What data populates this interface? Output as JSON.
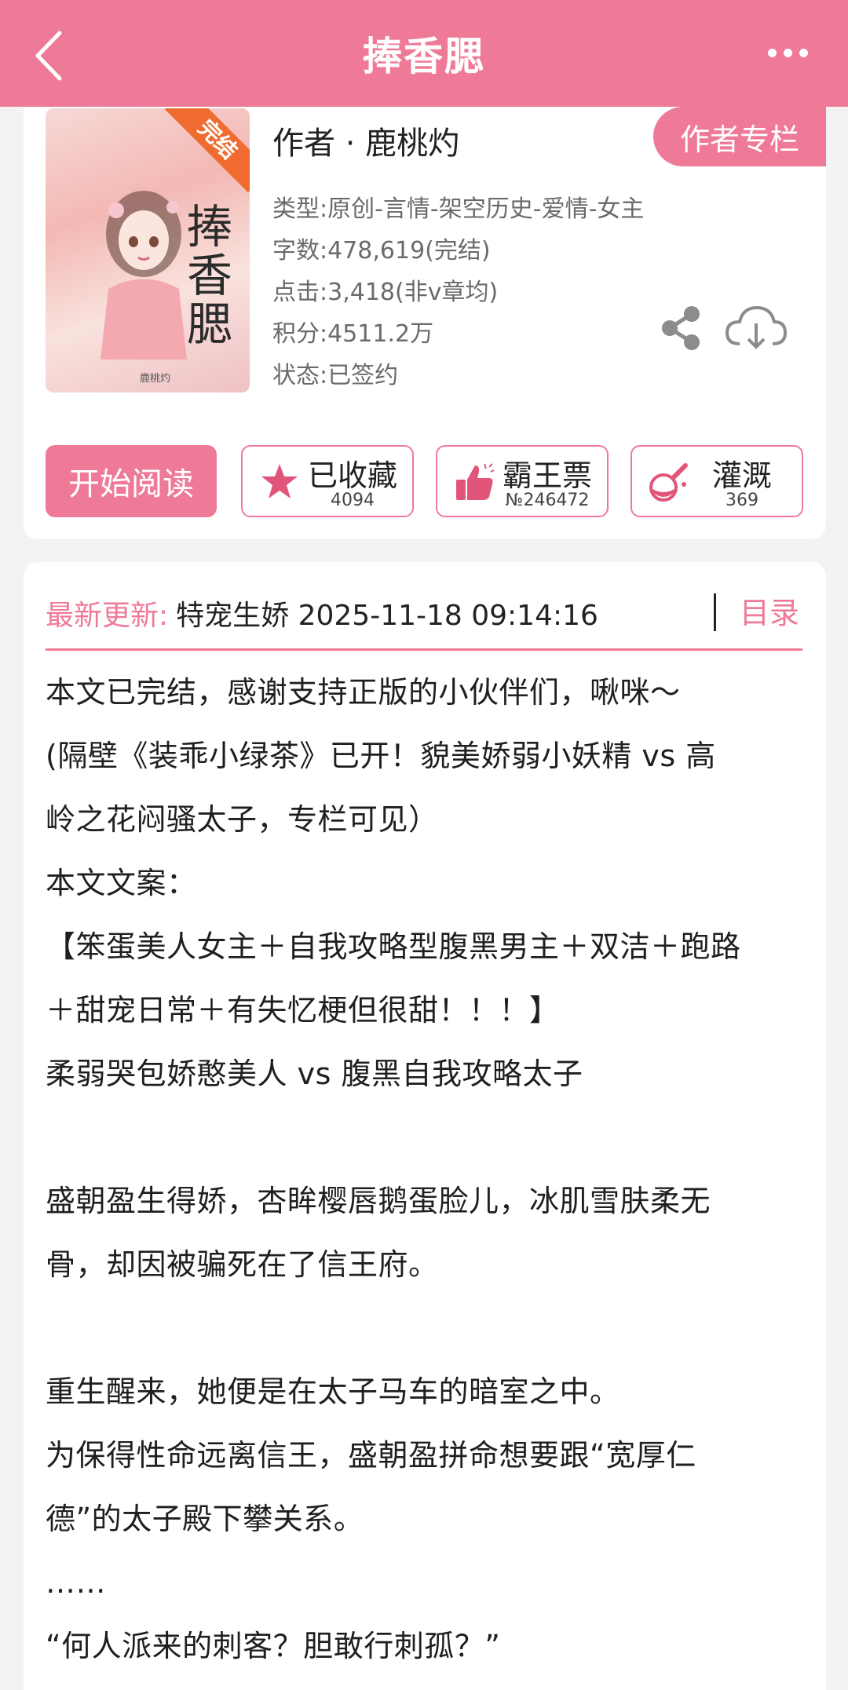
{
  "header": {
    "title": "捧香腮"
  },
  "book": {
    "cover_ribbon": "完结",
    "cover_calligraphy": "捧香腮",
    "cover_signature": "鹿桃灼",
    "author": "作者 · 鹿桃灼",
    "author_column_button": "作者专栏",
    "meta": {
      "type": "类型:原创-言情-架空历史-爱情-女主",
      "words": "字数:478,619(完结)",
      "clicks": "点击:3,418(非v章均)",
      "score": "积分:4511.2万",
      "status": "状态:已签约"
    }
  },
  "actions": {
    "start_reading": "开始阅读",
    "favorite": {
      "label": "已收藏",
      "count": "4094"
    },
    "bawang": {
      "label": "霸王票",
      "count": "№246472"
    },
    "irrigate": {
      "label": "灌溉",
      "count": "369"
    }
  },
  "update": {
    "label": "最新更新:",
    "text": "特宠生娇 2025-11-18 09:14:16",
    "toc": "目录"
  },
  "intro": {
    "lines": [
      "本文已完结，感谢支持正版的小伙伴们，啾咪～",
      "(隔壁《装乖小绿茶》已开！貌美娇弱小妖精 vs 高",
      "岭之花闷骚太子，专栏可见）",
      "本文文案：",
      "【笨蛋美人女主＋自我攻略型腹黑男主＋双洁＋跑路",
      "＋甜宠日常＋有失忆梗但很甜！！！】",
      "柔弱哭包娇憨美人 vs 腹黑自我攻略太子",
      "",
      "盛朝盈生得娇，杏眸樱唇鹅蛋脸儿，冰肌雪肤柔无",
      "骨，却因被骗死在了信王府。",
      "",
      "重生醒来，她便是在太子马车的暗室之中。",
      "为保得性命远离信王，盛朝盈拼命想要跟“宽厚仁",
      "德”的太子殿下攀关系。",
      "……",
      "“何人派来的刺客？胆敢行刺孤？”"
    ]
  },
  "colors": {
    "accent": "#ef7a98",
    "background": "#f3f3f5"
  }
}
